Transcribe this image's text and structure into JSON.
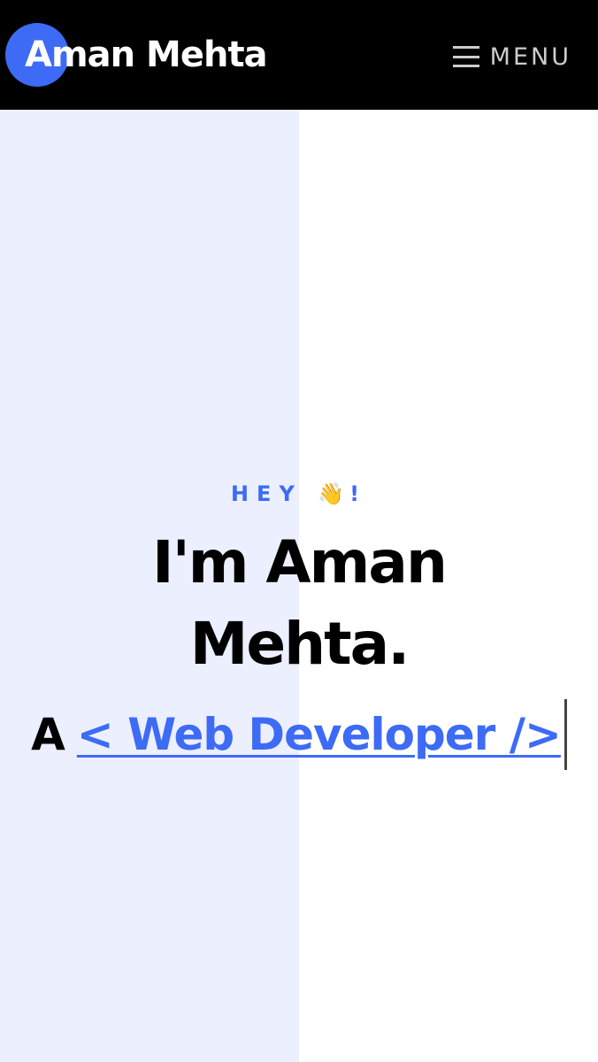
{
  "header": {
    "logo_text": "Aman Mehta",
    "menu_label": "MENU"
  },
  "hero": {
    "greeting": "HEY",
    "greeting_emoji": "👋",
    "greeting_punct": "!",
    "name_line1": "I'm Aman",
    "name_line2": "Mehta.",
    "role_prefix": "A",
    "role_text": "< Web Developer />"
  },
  "colors": {
    "accent": "#3d6bf5",
    "header_bg": "#000000",
    "left_panel": "#eceffe",
    "right_panel": "#ffffff"
  },
  "icons": {
    "menu": "hamburger-icon",
    "wave": "waving-hand-emoji"
  }
}
